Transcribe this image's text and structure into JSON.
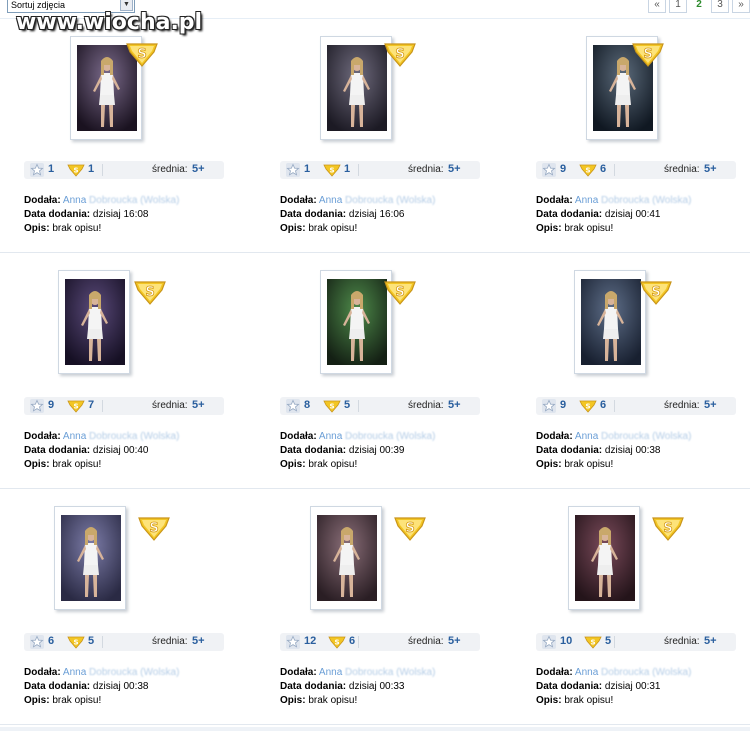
{
  "toolbar": {
    "sort_label": "Sortuj zdjęcia",
    "dropdown_arrow": "▼"
  },
  "watermark": "www.wiocha.pl",
  "pager": {
    "first": "«",
    "pages": [
      "1",
      "2",
      "3"
    ],
    "more": "»",
    "current": "2"
  },
  "labels": {
    "srednia": "średnia:",
    "dodala": "Dodała:",
    "data_dodania": "Data dodania:",
    "opis": "Opis:"
  },
  "colors": {
    "accent": "#2a5f9e",
    "link": "#6a9ed6",
    "current_page": "#2e8b2e"
  },
  "icons": {
    "rating": "star-icon",
    "super": "super-badge-icon"
  },
  "items": [
    {
      "votes": "1",
      "supers": "1",
      "avg": "5+",
      "author_first": "Anna",
      "author_rest": "Dobroucka (Wolska)",
      "date": "dzisiaj 16:08",
      "desc": "brak opisu!"
    },
    {
      "votes": "1",
      "supers": "1",
      "avg": "5+",
      "author_first": "Anna",
      "author_rest": "Dobroucka (Wolska)",
      "date": "dzisiaj 16:06",
      "desc": "brak opisu!"
    },
    {
      "votes": "9",
      "supers": "6",
      "avg": "5+",
      "author_first": "Anna",
      "author_rest": "Dobroucka (Wolska)",
      "date": "dzisiaj 00:41",
      "desc": "brak opisu!"
    },
    {
      "votes": "9",
      "supers": "7",
      "avg": "5+",
      "author_first": "Anna",
      "author_rest": "Dobroucka (Wolska)",
      "date": "dzisiaj 00:40",
      "desc": "brak opisu!"
    },
    {
      "votes": "8",
      "supers": "5",
      "avg": "5+",
      "author_first": "Anna",
      "author_rest": "Dobroucka (Wolska)",
      "date": "dzisiaj 00:39",
      "desc": "brak opisu!"
    },
    {
      "votes": "9",
      "supers": "6",
      "avg": "5+",
      "author_first": "Anna",
      "author_rest": "Dobroucka (Wolska)",
      "date": "dzisiaj 00:38",
      "desc": "brak opisu!"
    },
    {
      "votes": "6",
      "supers": "5",
      "avg": "5+",
      "author_first": "Anna",
      "author_rest": "Dobroucka (Wolska)",
      "date": "dzisiaj 00:38",
      "desc": "brak opisu!"
    },
    {
      "votes": "12",
      "supers": "6",
      "avg": "5+",
      "author_first": "Anna",
      "author_rest": "Dobroucka (Wolska)",
      "date": "dzisiaj 00:33",
      "desc": "brak opisu!"
    },
    {
      "votes": "10",
      "supers": "5",
      "avg": "5+",
      "author_first": "Anna",
      "author_rest": "Dobroucka (Wolska)",
      "date": "dzisiaj 00:31",
      "desc": "brak opisu!"
    }
  ]
}
